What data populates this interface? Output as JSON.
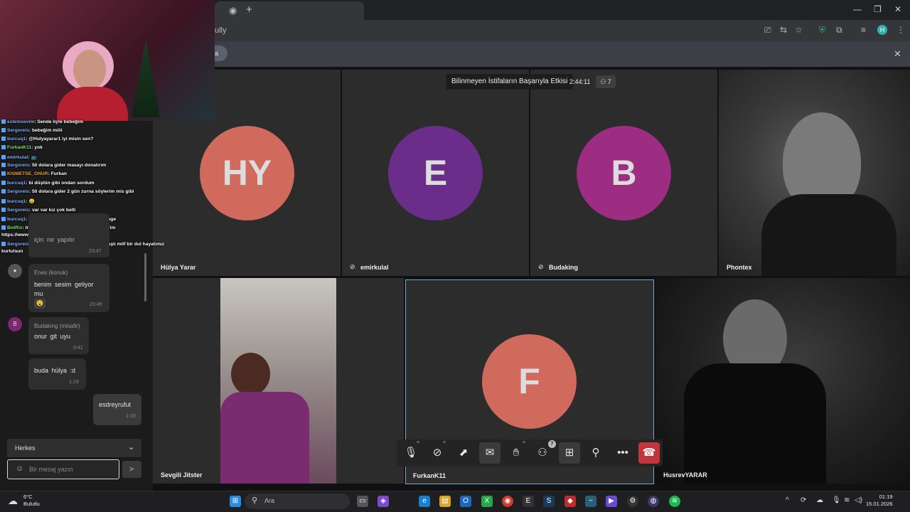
{
  "browser": {
    "url_fragment": "ully",
    "notification_chip": "la"
  },
  "meeting": {
    "title": "Bilinmeyen İstifaların Başarıyla Etkisi",
    "timer": "2:44:11",
    "participant_count": "7",
    "tiles": [
      {
        "name": "Hülya Yarar",
        "initials": "HY",
        "color": "#d06a5c",
        "muted": false
      },
      {
        "name": "emirkulal",
        "initials": "E",
        "color": "#6b2d8a",
        "muted": true
      },
      {
        "name": "Budaking",
        "initials": "B",
        "color": "#9d2d82",
        "muted": true
      },
      {
        "name": "Phontex"
      },
      {
        "name": "Sevgili Jitster"
      },
      {
        "name": "FurkanK11",
        "initials": "F",
        "color": "#d06a5c"
      },
      {
        "name": "HusrevYARAR"
      }
    ],
    "toolbar": {
      "participants_badge": "7"
    }
  },
  "stream_chat": [
    {
      "user": "estemsevim",
      "text": ": Sende öyle bebeğim"
    },
    {
      "user": "Sergoreis",
      "text": ": bebeğim miiii"
    },
    {
      "user": "burcuq1",
      "text": ": @Hulyayarar1 iyi misin sen?"
    },
    {
      "user": "FurkanK11",
      "text": ": yok"
    },
    {
      "user": "emirkulal",
      "text": ": 📺"
    },
    {
      "user": "Sergoreis",
      "text": ": 50 dolara gider masayı donatırım"
    },
    {
      "user": "KISMETSE_ONUR",
      "text": ": Furkan"
    },
    {
      "user": "burcuq1",
      "text": ": bi düştün gibi ondan sordum"
    },
    {
      "user": "Sergoreis",
      "text": ": 50 dolara gider 2 gün zurna söylerim mis gibi"
    },
    {
      "user": "burcuq1",
      "text": ": 😀"
    },
    {
      "user": "Sergoreis",
      "text": ": var var kız çok belli"
    },
    {
      "user": "burcuq1",
      "text": ": furkanım sen ne zaman bulucan yenge"
    },
    {
      "user": "BotRix",
      "text": ": Instagram'dan takip ederseniz sevinirim"
    },
    {
      "user": "",
      "text": "https://www.instagram.com/hulyayarar/"
    },
    {
      "user": "Sergoreis",
      "text": ": hüsrevim yok mu bizi de bi tane yaşlı milf bir dul hayatımız"
    },
    {
      "user": "",
      "text": "kurtulsun"
    }
  ],
  "meet_chat": {
    "partial_text": "için  ne  yapılır",
    "partial_time": "23:47",
    "messages": [
      {
        "name": "Enes (konuk)",
        "text": "benim  sesim  geliyor  mu",
        "reaction": "😮",
        "time": "23:49"
      },
      {
        "name": "Budaking (misafir)",
        "avatar": "B",
        "text": "onur  git  uyu",
        "time": "0:41"
      },
      {
        "text": "buda  hülya  :d",
        "time": "1:19"
      },
      {
        "text": "esdreyrufut",
        "time": "1:19"
      }
    ],
    "recipients": "Herkes",
    "input_placeholder": "Bir mesaj yazın"
  },
  "taskbar": {
    "weather_temp": "6°C",
    "weather_desc": "Bulutlu",
    "search_label": "Ara",
    "time": "01:19",
    "date": "15.01.2026"
  }
}
